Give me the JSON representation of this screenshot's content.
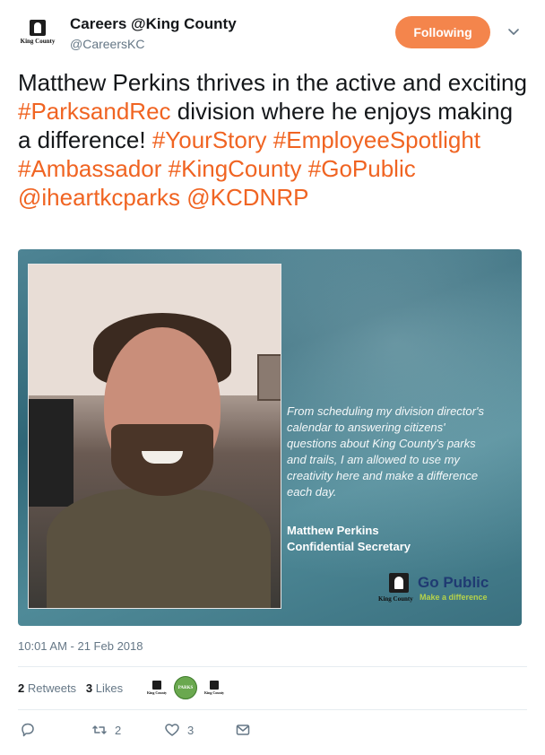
{
  "header": {
    "name": "Careers @King County",
    "handle": "@CareersKC",
    "follow_label": "Following",
    "avatar_text": "King County"
  },
  "tweet": {
    "text_parts": [
      {
        "text": "Matthew Perkins thrives in the active and exciting ",
        "tag": false
      },
      {
        "text": "#ParksandRec",
        "tag": true
      },
      {
        "text": " division where he enjoys making a difference! ",
        "tag": false
      },
      {
        "text": "#YourStory",
        "tag": true
      },
      {
        "text": " ",
        "tag": false
      },
      {
        "text": "#EmployeeSpotlight",
        "tag": true
      },
      {
        "text": " ",
        "tag": false
      },
      {
        "text": "#Ambassador",
        "tag": true
      },
      {
        "text": " ",
        "tag": false
      },
      {
        "text": "#KingCounty",
        "tag": true
      },
      {
        "text": " ",
        "tag": false
      },
      {
        "text": "#GoPublic",
        "tag": true
      },
      {
        "text": " ",
        "tag": false
      },
      {
        "text": "@iheartkcparks",
        "tag": true
      },
      {
        "text": " ",
        "tag": false
      },
      {
        "text": "@KCDNRP",
        "tag": true
      }
    ]
  },
  "media": {
    "quote": "From scheduling my division director's calendar to answering citizens' questions about King County's parks and trails, I am allowed to use my creativity here and make a difference each day.",
    "person_name": "Matthew Perkins",
    "person_title": "Confidential Secretary",
    "brand_title": "Go Public",
    "brand_subtitle": "Make a difference",
    "brand_org": "King County"
  },
  "timestamp": "10:01 AM - 21 Feb 2018",
  "stats": {
    "retweets_count": "2",
    "retweets_label": "Retweets",
    "likes_count": "3",
    "likes_label": "Likes",
    "liker_labels": [
      "King County",
      "PARKS",
      "King County"
    ]
  },
  "actions": {
    "reply_count": "",
    "retweet_count": "2",
    "like_count": "3"
  },
  "colors": {
    "accent": "#f06422",
    "follow_button": "#f4854c",
    "muted": "#657786",
    "text": "#14171a"
  }
}
